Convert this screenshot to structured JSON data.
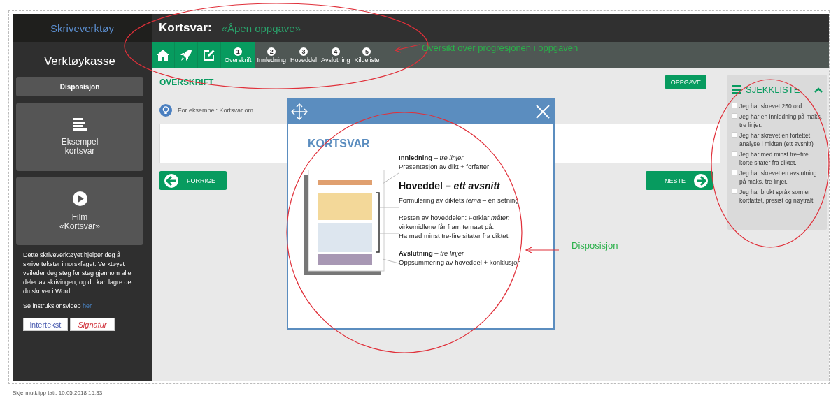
{
  "sidebar": {
    "title": "Skriveverktøy",
    "heading": "Verktøykasse",
    "tools": [
      {
        "kind": "button",
        "lines": [
          "Disposisjon"
        ]
      },
      {
        "kind": "example",
        "lines": [
          "Eksempel",
          "kortsvar"
        ]
      },
      {
        "kind": "film",
        "lines": [
          "Film",
          "«Kortsvar»"
        ]
      }
    ],
    "description": "Dette skriveverktøyet hjelper deg å skrive tekster i norskfaget. Verktøyet veileder deg steg for steg gjennom alle deler av skrivingen, og du kan lagre det du skriver i Word.",
    "video_line": {
      "text": "Se instruksjonsvideo",
      "link": "her"
    },
    "logos": [
      {
        "kind": "intertekst",
        "text": "intertekst"
      },
      {
        "kind": "signatur",
        "text": "Signatur"
      }
    ]
  },
  "header": {
    "title": "Kortsvar:",
    "subtitle": "«Åpen oppgave»"
  },
  "steps": [
    {
      "number": "1",
      "label": "Overskrift",
      "selected": true
    },
    {
      "number": "2",
      "label": "Innledning",
      "selected": false
    },
    {
      "number": "3",
      "label": "Hoveddel",
      "selected": false
    },
    {
      "number": "4",
      "label": "Avslutning",
      "selected": false
    },
    {
      "number": "5",
      "label": "Kildeliste",
      "selected": false
    }
  ],
  "content": {
    "section_title": "OVERSKRIFT",
    "task_button": "OPPGAVE",
    "hint": "For eksempel: Kortsvar om ...",
    "prev_button": "FORRIGE",
    "next_button": "NESTE"
  },
  "checklist": {
    "title": "SJEKKLISTE",
    "expanded": true,
    "items": [
      {
        "text": "Jeg har skrevet 250 ord.",
        "checked": false
      },
      {
        "text": "Jeg har en innledning på maks. tre linjer.",
        "checked": false
      },
      {
        "text": "Jeg har skrevet en fortettet analyse i midten (ett avsnitt)",
        "checked": false
      },
      {
        "text": "Jeg har med minst tre–fire korte sitater fra diktet.",
        "checked": false
      },
      {
        "text": "Jeg har skrevet en avslutning på maks. tre linjer.",
        "checked": false
      },
      {
        "text": "Jeg har brukt språk som er kortfattet, presist og nøytralt.",
        "checked": false
      }
    ]
  },
  "modal": {
    "title": "KORTSVAR",
    "blocks": [
      {
        "kind": "section",
        "lines": [
          "**Innledning** – *tre linjer*",
          "Presentasjon av dikt + forfatter"
        ]
      },
      {
        "kind": "heading",
        "lines": [
          "Hoveddel – *ett avsnitt*"
        ]
      },
      {
        "kind": "section",
        "lines": [
          "Formulering av diktets *tema* – én setning"
        ]
      },
      {
        "kind": "section",
        "lines": [
          "Resten av hoveddelen: Forklar *måten*",
          "virkemidlene får fram temaet på.",
          "Ha med minst tre-fire sitater fra diktet."
        ]
      },
      {
        "kind": "section",
        "lines": [
          "**Avslutning** – *tre linjer*",
          "Oppsummering av hoveddel + konklusjon"
        ]
      }
    ]
  },
  "annotations": [
    {
      "text": "Oversikt over progresjonen i oppgaven"
    },
    {
      "text": "Disposisjon"
    }
  ],
  "footer": "Skjermutklipp tatt: 10.05.2018 15.33"
}
